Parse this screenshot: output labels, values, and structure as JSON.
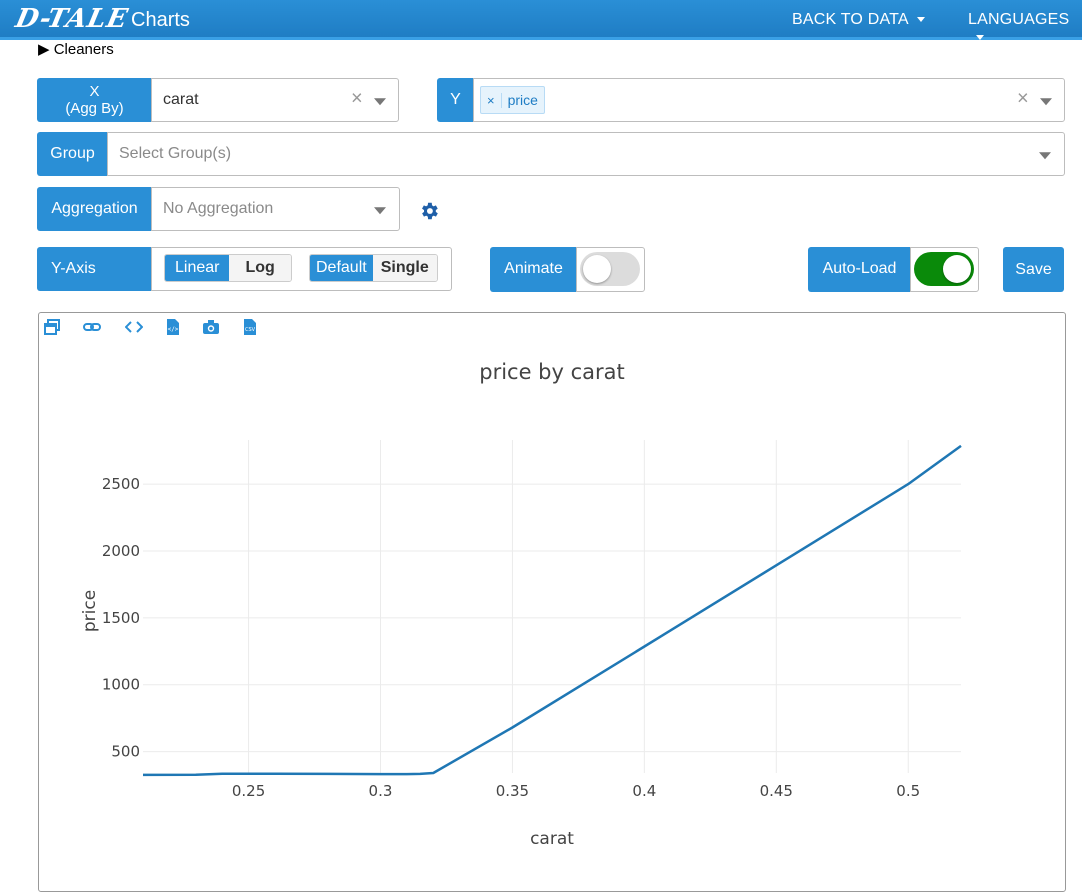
{
  "header": {
    "logo_text": "D-TALE",
    "app_title": "Charts",
    "nav": [
      {
        "label": "BACK TO DATA"
      },
      {
        "label": "LANGUAGES"
      }
    ]
  },
  "cleaners": {
    "label": "▶ Cleaners"
  },
  "x_control": {
    "label": "X\n(Agg By)",
    "value": "carat"
  },
  "y_control": {
    "label": "Y",
    "chips": [
      "price"
    ],
    "chip_remove": "×"
  },
  "group_control": {
    "label": "Group",
    "placeholder": "Select Group(s)"
  },
  "aggregation_control": {
    "label": "Aggregation",
    "placeholder": "No Aggregation"
  },
  "y_axis_control": {
    "label": "Y-Axis",
    "scale_options": [
      "Linear",
      "Log"
    ],
    "scale_selected": "Linear",
    "mode_options": [
      "Default",
      "Single"
    ],
    "mode_selected": "Default"
  },
  "animate": {
    "label": "Animate",
    "on": false
  },
  "auto_load": {
    "label": "Auto-Load",
    "on": true
  },
  "save": {
    "label": "Save"
  },
  "toolbar_icons": [
    "popup-icon",
    "link-icon",
    "code-icon",
    "export-html-icon",
    "camera-icon",
    "csv-icon"
  ],
  "colors": {
    "accent": "#2a8fd6",
    "toggle_on": "#0a8a0a",
    "line": "#1f77b4"
  },
  "chart_data": {
    "type": "line",
    "title": "price by carat",
    "xlabel": "carat",
    "ylabel": "price",
    "x": [
      0.21,
      0.23,
      0.24,
      0.26,
      0.28,
      0.3,
      0.31,
      0.315,
      0.32,
      0.35,
      0.4,
      0.45,
      0.5,
      0.52
    ],
    "y": [
      326,
      327,
      335,
      334,
      333,
      332,
      332,
      333,
      340,
      680,
      1286,
      1893,
      2500,
      2786
    ],
    "xlim": [
      0.21,
      0.52
    ],
    "ylim": [
      340,
      2830
    ],
    "x_ticks": [
      0.25,
      0.3,
      0.35,
      0.4,
      0.45,
      0.5
    ],
    "x_tick_labels": [
      "0.25",
      "0.3",
      "0.35",
      "0.4",
      "0.45",
      "0.5"
    ],
    "y_ticks": [
      500,
      1000,
      1500,
      2000,
      2500
    ],
    "y_tick_labels": [
      "500",
      "1000",
      "1500",
      "2000",
      "2500"
    ],
    "grid": true
  }
}
